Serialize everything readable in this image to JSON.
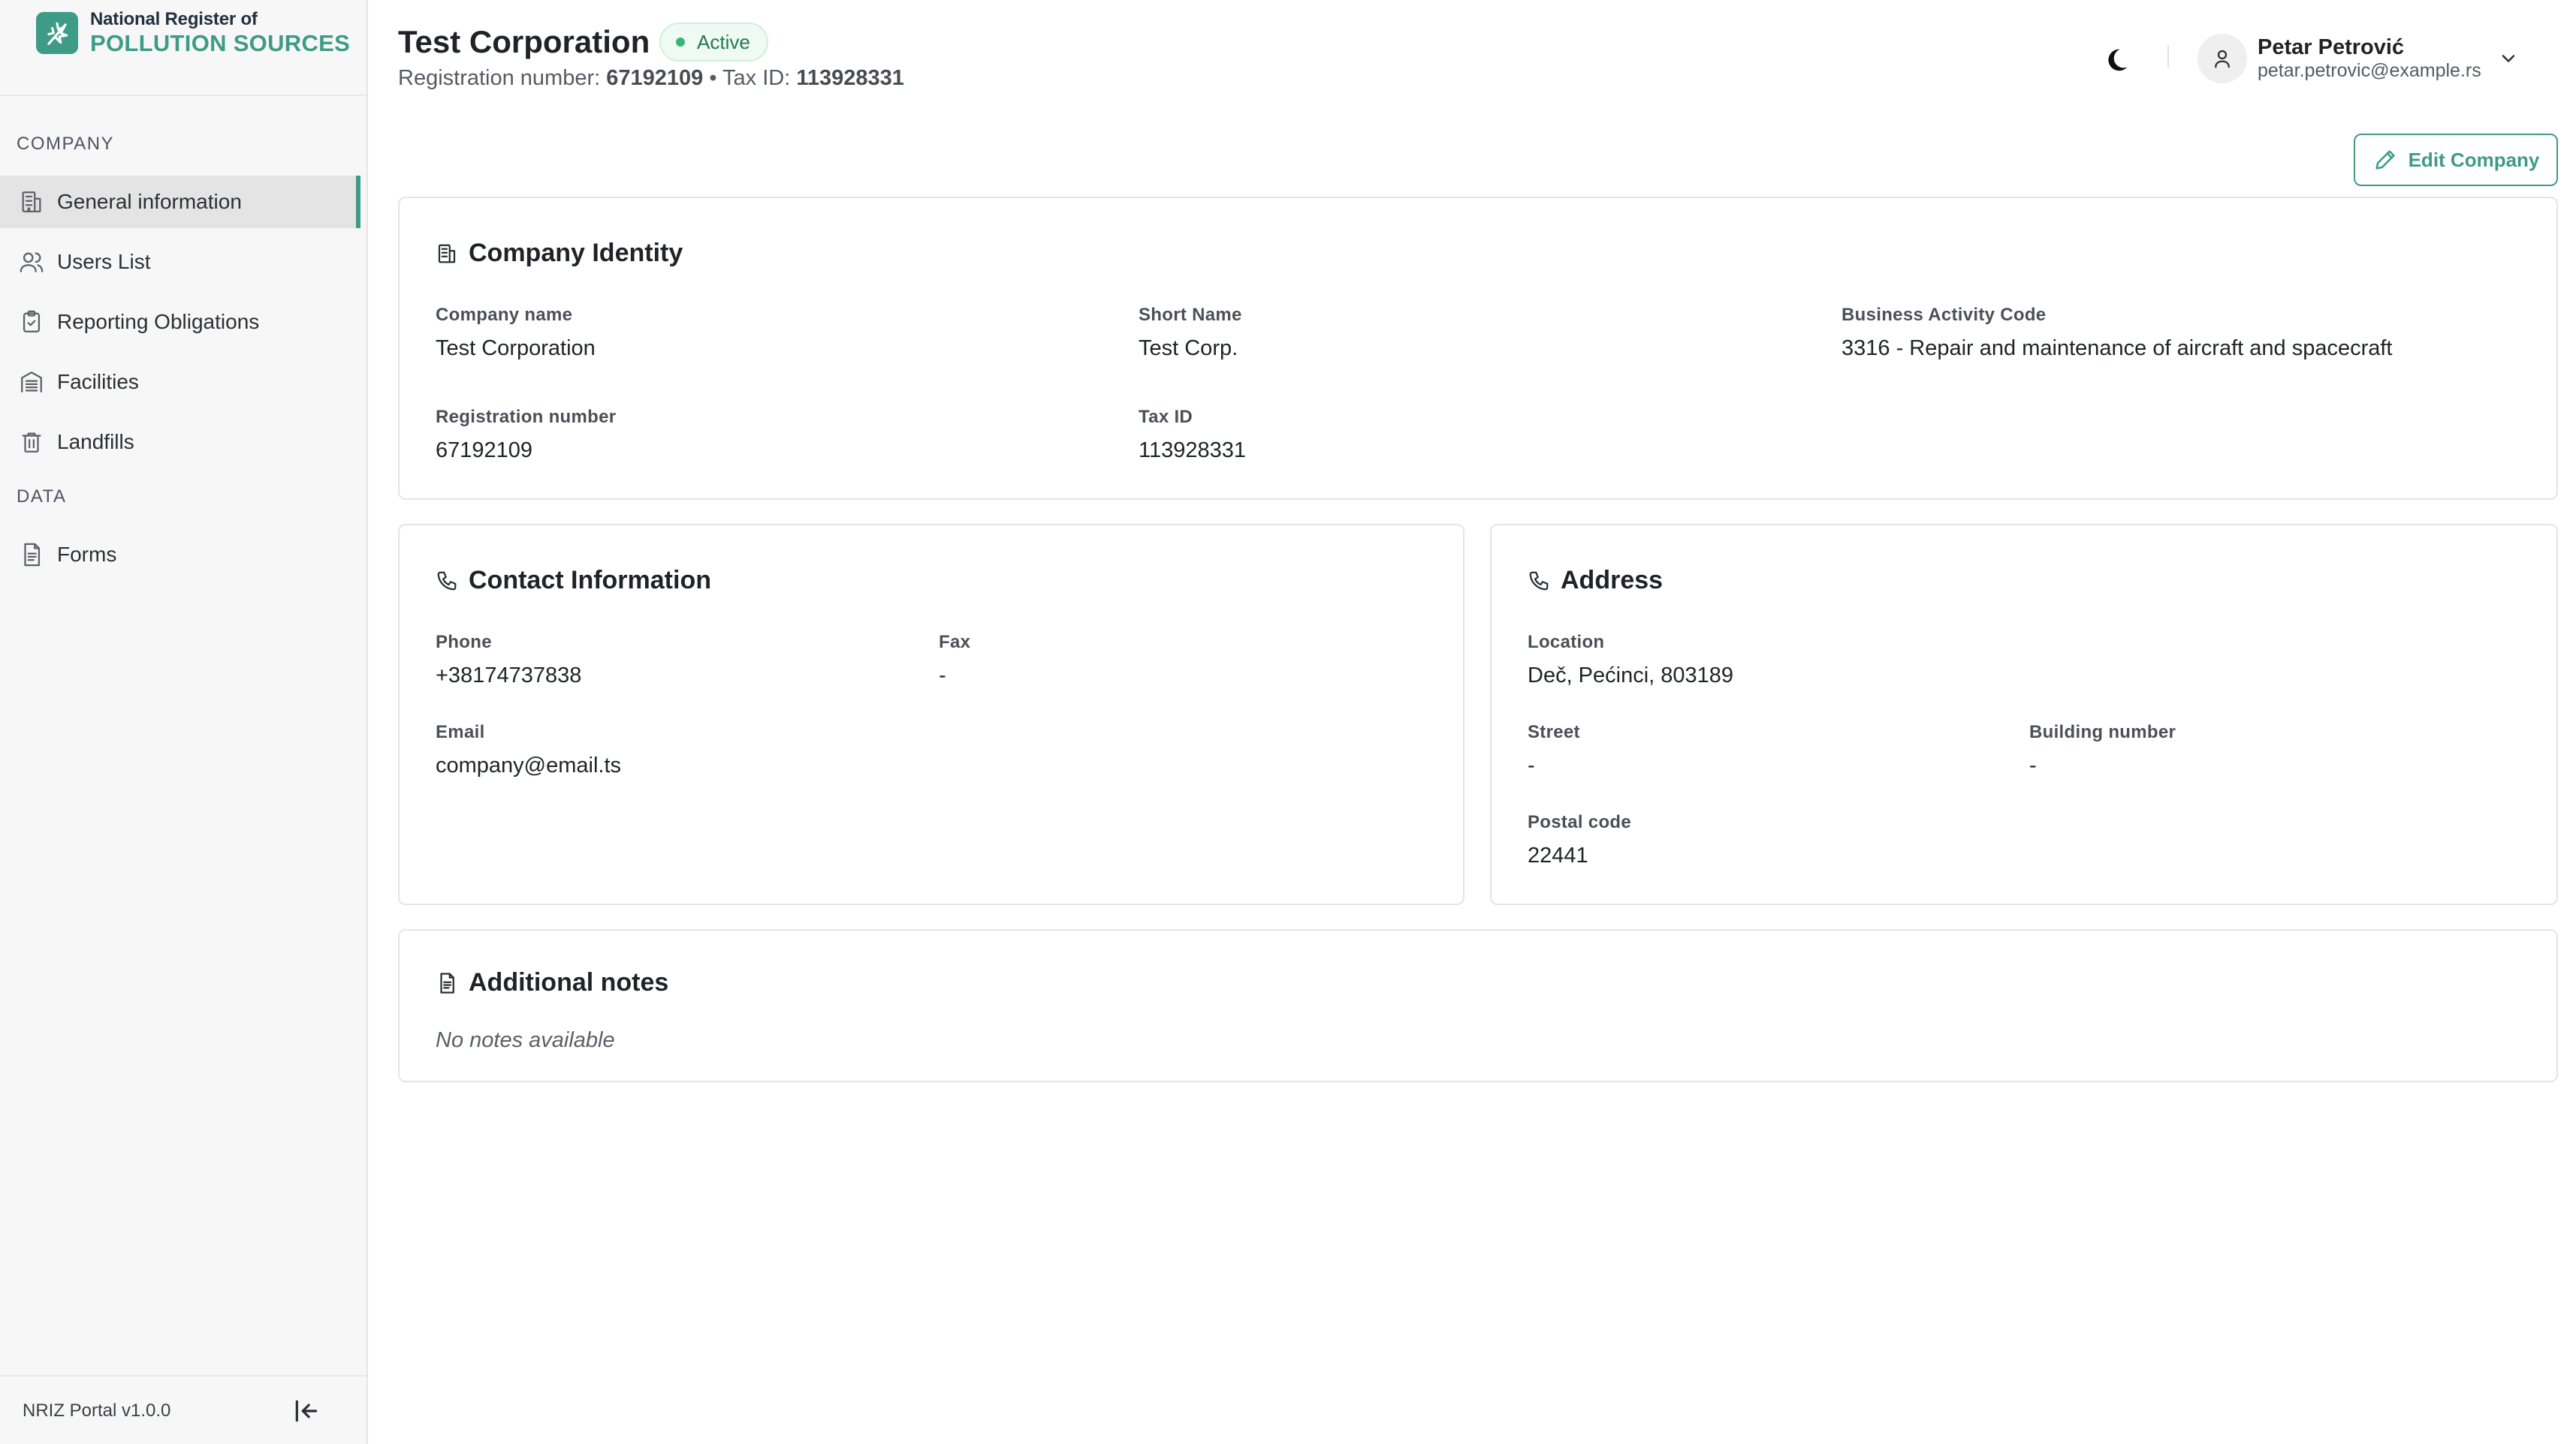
{
  "brand": {
    "line1": "National Register of",
    "line2": "POLLUTION SOURCES"
  },
  "sidebar": {
    "sections": [
      {
        "label": "COMPANY"
      },
      {
        "label": "DATA"
      }
    ],
    "items": [
      {
        "label": "General information",
        "icon": "building-icon",
        "active": true
      },
      {
        "label": "Users List",
        "icon": "users-icon"
      },
      {
        "label": "Reporting Obligations",
        "icon": "clipboard-check-icon"
      },
      {
        "label": "Facilities",
        "icon": "facility-icon"
      },
      {
        "label": "Landfills",
        "icon": "trash-icon"
      },
      {
        "label": "Forms",
        "icon": "document-icon"
      }
    ],
    "version": "NRIZ Portal v1.0.0"
  },
  "header": {
    "title": "Test Corporation",
    "status": "Active",
    "reg_label": "Registration number:",
    "reg_value": "67192109",
    "separator": "•",
    "tax_label": "Tax ID:",
    "tax_value": "113928331"
  },
  "user": {
    "name": "Petar Petrović",
    "email": "petar.petrovic@example.rs"
  },
  "actions": {
    "edit_label": "Edit Company"
  },
  "identity": {
    "title": "Company Identity",
    "company_name_label": "Company name",
    "company_name": "Test Corporation",
    "short_name_label": "Short Name",
    "short_name": "Test Corp.",
    "activity_label": "Business Activity Code",
    "activity": "3316 - Repair and maintenance of aircraft and spacecraft",
    "reg_label": "Registration number",
    "reg_value": "67192109",
    "tax_label": "Tax ID",
    "tax_value": "113928331"
  },
  "contact": {
    "title": "Contact Information",
    "phone_label": "Phone",
    "phone": "+38174737838",
    "fax_label": "Fax",
    "fax": "-",
    "email_label": "Email",
    "email": "company@email.ts"
  },
  "address": {
    "title": "Address",
    "location_label": "Location",
    "location": "Deč, Pećinci, 803189",
    "street_label": "Street",
    "street": "-",
    "building_label": "Building number",
    "building": "-",
    "postal_label": "Postal code",
    "postal": "22441"
  },
  "notes": {
    "title": "Additional notes",
    "empty": "No notes available"
  },
  "colors": {
    "accent": "#3e9b87",
    "status_green": "#37b673"
  }
}
